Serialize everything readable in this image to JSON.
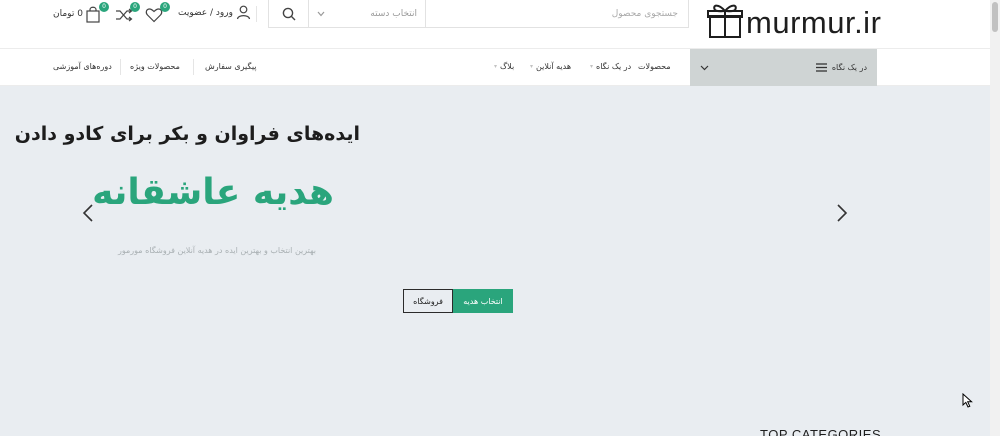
{
  "header": {
    "logo_text": "murmur.ir",
    "search": {
      "placeholder": "جستجوی محصول",
      "category_select": "انتخاب دسته"
    },
    "account_label": "ورود / عضویت",
    "wishlist_count": "0",
    "compare_count": "0",
    "cart_count": "0",
    "cart_total": "0 تومان"
  },
  "nav": {
    "category_menu": "در یک نگاه",
    "links": {
      "products": "محصولات",
      "at_a_glance": "در یک نگاه",
      "online_gift": "هدیه آنلاین",
      "blog": "بلاگ",
      "order_tracking": "پیگیری سفارش",
      "special_products": "محصولات ویژه",
      "courses": "دوره‌های آموزشی"
    }
  },
  "hero": {
    "subtitle": "ایده‌های فراوان و بکر برای کادو دادن",
    "title": "هدیه عاشقانه",
    "description": "بهترین انتخاب و بهترین ایده در هدیه آنلاین فروشگاه مورمور",
    "primary_button": "انتخاب هدیه",
    "secondary_button": "فروشگاه"
  },
  "section_heading": "TOP CATEGORIES",
  "colors": {
    "accent": "#2aa57c",
    "hero_bg": "#e9edf1",
    "category_bar": "#cfd4d4"
  },
  "icons": {
    "search": "search-icon",
    "dropdown": "chevron-down-icon",
    "account": "user-icon",
    "wishlist": "heart-icon",
    "compare": "shuffle-icon",
    "cart": "shopping-bag-icon",
    "menu": "hamburger-icon",
    "prev": "chevron-left-icon",
    "next": "chevron-right-icon"
  }
}
